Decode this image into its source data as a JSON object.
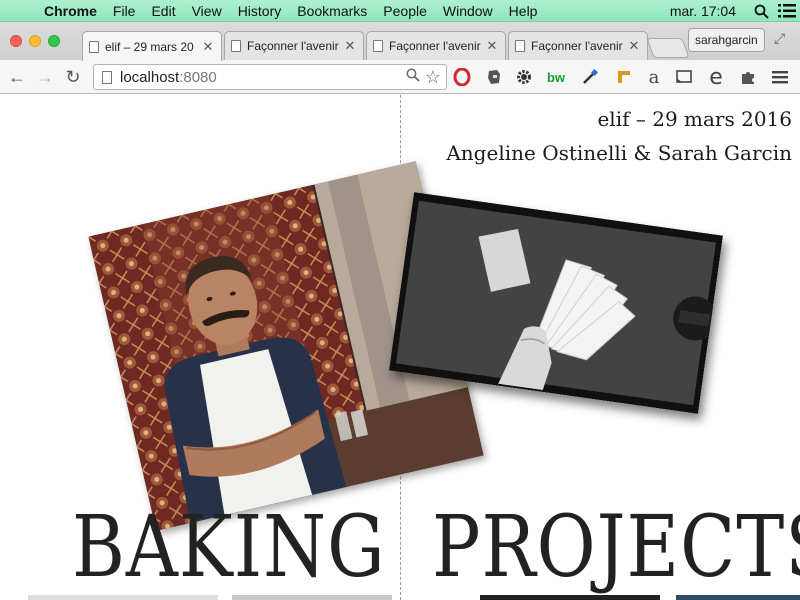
{
  "menubar": {
    "app": "Chrome",
    "items": [
      "File",
      "Edit",
      "View",
      "History",
      "Bookmarks",
      "People",
      "Window",
      "Help"
    ],
    "clock": "mar. 17:04"
  },
  "tabs": [
    {
      "label": "elif – 29 mars 20",
      "active": true
    },
    {
      "label": "Façonner l'avenir",
      "active": false
    },
    {
      "label": "Façonner l'avenir",
      "active": false
    },
    {
      "label": "Façonner l'avenir",
      "active": false
    }
  ],
  "profile": "sarahgarcin",
  "omnibox": {
    "host": "localhost",
    "port": ":8080"
  },
  "extensions": [
    "opera-icon",
    "evernote-icon",
    "gear-icon",
    "bw-icon",
    "eyedropper-icon",
    "ruler-icon",
    "amazon-icon",
    "cast-icon",
    "e-icon",
    "puzzle-icon",
    "menu-icon"
  ],
  "page": {
    "date_line": "elif – 29 mars 2016",
    "authors": "Angeline Ostinelli & Sarah Garcin",
    "word_left": "BAKING",
    "word_right": "PROJECTS"
  },
  "colors": {
    "menubar": "#9feac6",
    "close": "#fc5f57",
    "minimize": "#fdbc2e",
    "maximize": "#34c84a"
  }
}
